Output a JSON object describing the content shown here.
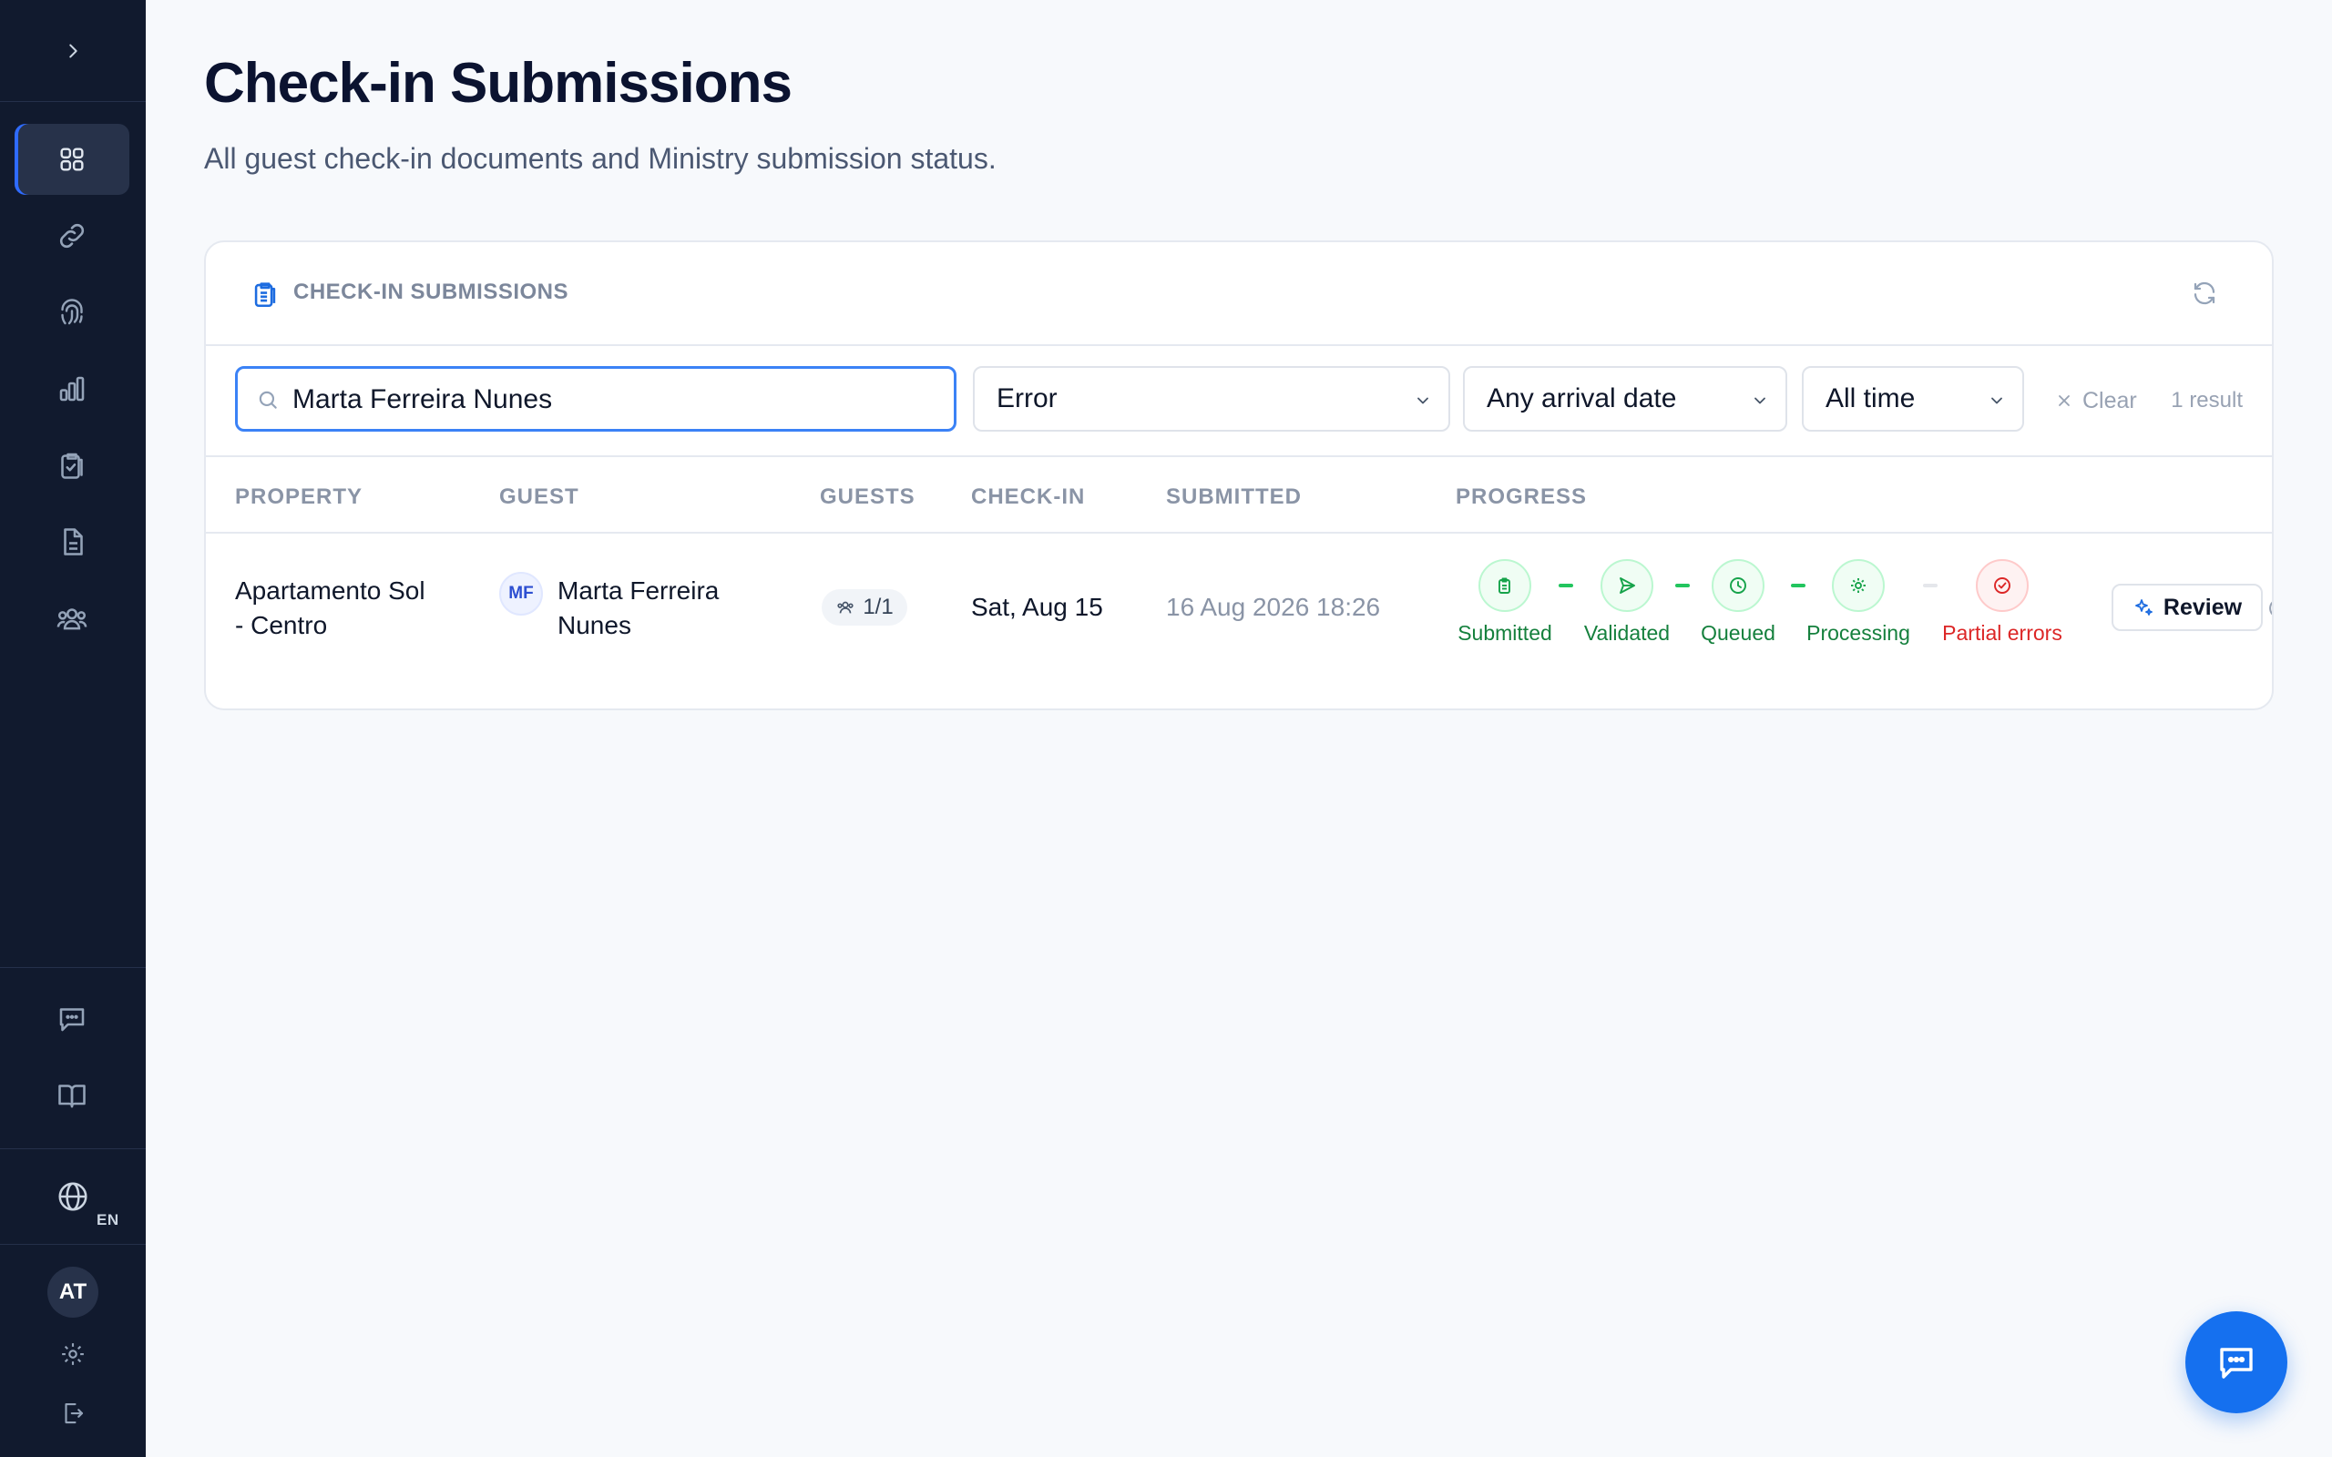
{
  "sidebar": {
    "lang_code": "EN",
    "user_initials": "AT",
    "nav_icons": [
      "grid-icon",
      "link-icon",
      "fingerprint-icon",
      "bar-chart-icon",
      "clipboard-check-icon",
      "document-icon",
      "users-icon"
    ],
    "bottom_icons": [
      "chat-icon",
      "book-icon",
      "globe-icon",
      "gear-icon",
      "logout-icon"
    ]
  },
  "header": {
    "title": "Check-in Submissions",
    "subtitle": "All guest check-in documents and Ministry submission status."
  },
  "card": {
    "title": "CHECK-IN SUBMISSIONS",
    "filters": {
      "search_value": "Marta Ferreira Nunes",
      "status_selected": "Error",
      "arrival_selected": "Any arrival date",
      "period_selected": "All time",
      "clear_label": "Clear",
      "result_count": "1 result"
    },
    "columns": [
      "PROPERTY",
      "GUEST",
      "GUESTS",
      "CHECK-IN",
      "SUBMITTED",
      "PROGRESS"
    ],
    "rows": [
      {
        "property_line1": "Apartamento Sol",
        "property_line2": "- Centro",
        "guest_initials": "MF",
        "guest_line1": "Marta Ferreira",
        "guest_line2": "Nunes",
        "guests": "1/1",
        "checkin": "Sat, Aug 15",
        "submitted": "16 Aug 2026 18:26",
        "progress": [
          {
            "label": "Submitted",
            "state": "done"
          },
          {
            "label": "Validated",
            "state": "done"
          },
          {
            "label": "Queued",
            "state": "done"
          },
          {
            "label": "Processing",
            "state": "done"
          },
          {
            "label": "Partial errors",
            "state": "error"
          }
        ],
        "action_label": "Review"
      }
    ]
  },
  "colors": {
    "sidebar_bg": "#111a2e",
    "accent": "#3b82f6",
    "success": "#15803d",
    "error": "#dc2626",
    "fab": "#1570ef"
  }
}
